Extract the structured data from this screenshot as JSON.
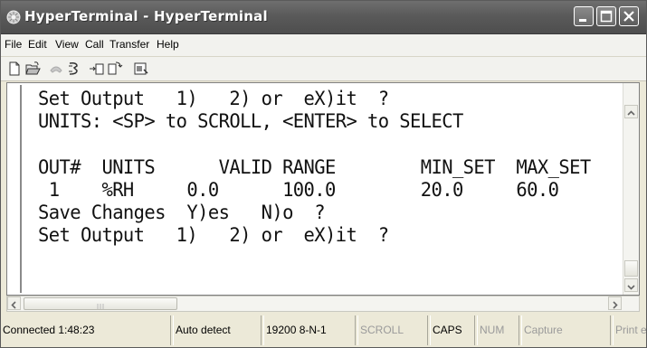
{
  "window": {
    "title": "HyperTerminal - HyperTerminal"
  },
  "menu": {
    "items": [
      "File",
      "Edit",
      "View",
      "Call",
      "Transfer",
      "Help"
    ]
  },
  "toolbar": {
    "icons": [
      "new-icon",
      "open-icon",
      "connect-icon",
      "disconnect-icon",
      "send-icon",
      "receive-icon",
      "properties-icon"
    ]
  },
  "terminal": {
    "lines": [
      "Set Output   1)   2) or  eX)it  ?",
      "UNITS: <SP> to SCROLL, <ENTER> to SELECT",
      "",
      "OUT#  UNITS      VALID RANGE        MIN_SET  MAX_SET",
      " 1    %RH     0.0      100.0        20.0     60.0",
      "Save Changes  Y)es   N)o  ?",
      "Set Output   1)   2) or  eX)it  ?"
    ]
  },
  "statusbar": {
    "connected": "Connected 1:48:23",
    "detect": "Auto detect",
    "settings": "19200 8-N-1",
    "scroll": "SCROLL",
    "caps": "CAPS",
    "num": "NUM",
    "capture": "Capture",
    "print": "Print echo"
  }
}
